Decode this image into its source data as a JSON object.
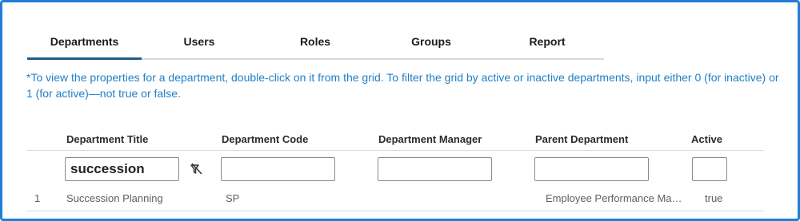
{
  "tabs": [
    {
      "label": "Departments",
      "active": true
    },
    {
      "label": "Users",
      "active": false
    },
    {
      "label": "Roles",
      "active": false
    },
    {
      "label": "Groups",
      "active": false
    },
    {
      "label": "Report",
      "active": false
    }
  ],
  "instruction": "*To view the properties for a department, double-click on it from the grid. To filter the grid by active or inactive departments, input either 0 (for inactive) or 1 (for active)—not true or false.",
  "grid": {
    "columns": [
      "Department Title",
      "Department Code",
      "Department Manager",
      "Parent Department",
      "Active"
    ],
    "filters": {
      "title": "succession",
      "code": "",
      "manager": "",
      "parent": "",
      "active": ""
    },
    "clear_filter_icon": "clear-filter-icon",
    "rows": [
      {
        "number": "1",
        "title": "Succession Planning",
        "code": "SP",
        "manager": "",
        "parent": "Employee Performance Management",
        "active": "true"
      }
    ]
  },
  "colors": {
    "frame_border": "#1d7fd6",
    "instruction_text": "#1f7fc6",
    "active_tab_underline": "#1e5c8a"
  }
}
